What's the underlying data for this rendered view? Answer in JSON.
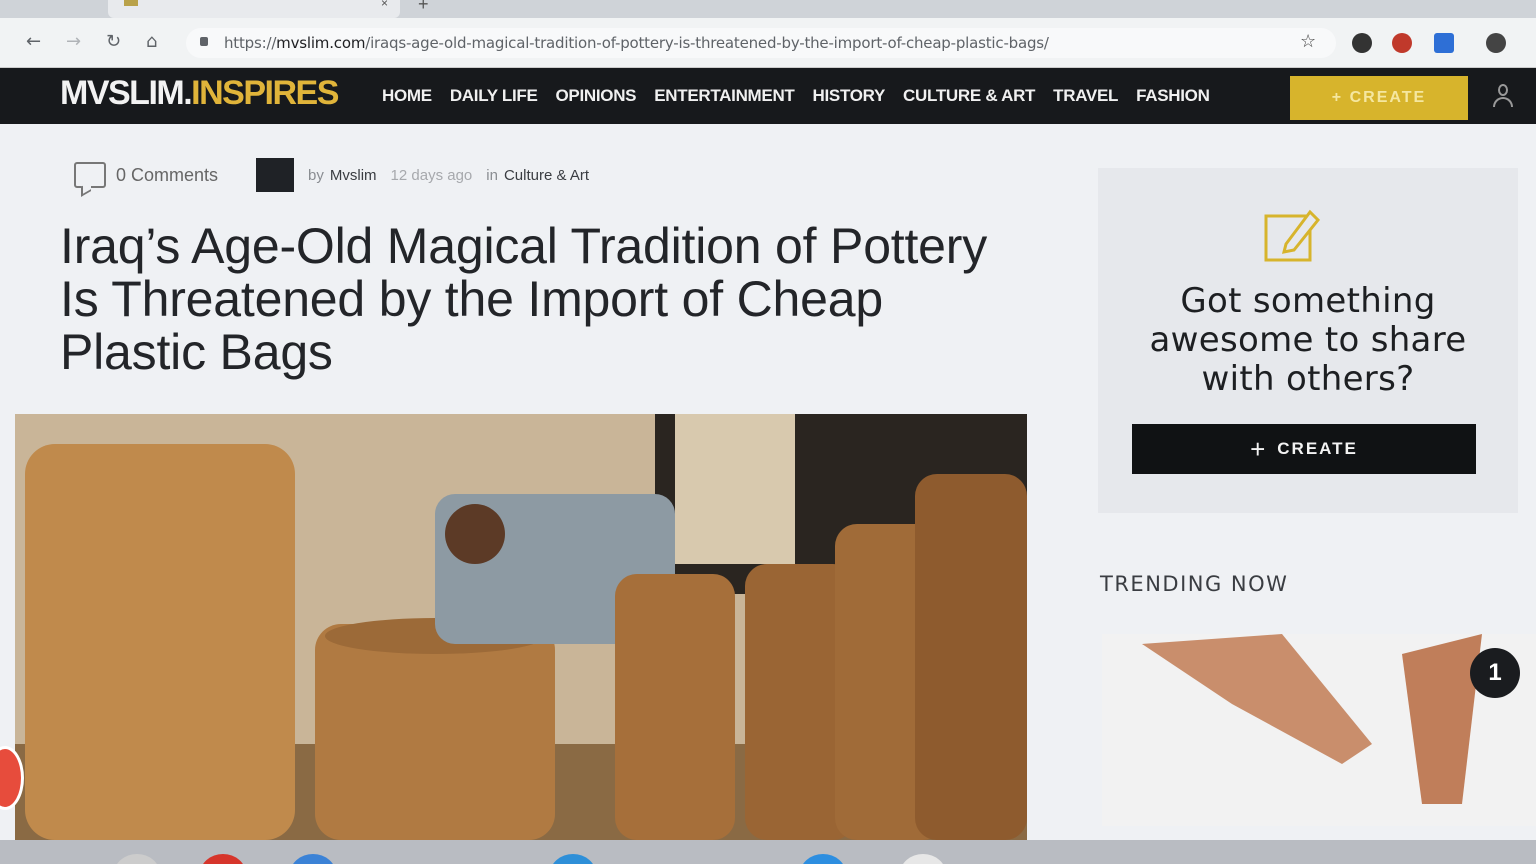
{
  "browser": {
    "url_prefix": "https://",
    "url_host": "mvslim.com",
    "url_path": "/iraqs-age-old-magical-tradition-of-pottery-is-threatened-by-the-import-of-cheap-plastic-bags/",
    "back_icon": "back-arrow-icon",
    "forward_icon": "forward-arrow-icon",
    "reload_icon": "reload-icon",
    "home_icon": "home-icon"
  },
  "site": {
    "logo_main": "MVSLIM.",
    "logo_accent": "INSPIRES",
    "accent_color": "#e0b43a",
    "menu": [
      "HOME",
      "DAILY LIFE",
      "OPINIONS",
      "ENTERTAINMENT",
      "HISTORY",
      "CULTURE & ART",
      "TRAVEL",
      "FASHION"
    ],
    "create_label": "+ CREATE"
  },
  "article": {
    "comments": "0 Comments",
    "by": "by",
    "author": "Mvslim",
    "time": "12 days ago",
    "in": "in",
    "category": "Culture & Art",
    "title": "Iraq’s Age-Old Magical Tradition of Pottery Is Threatened by the Import of Cheap Plastic Bags"
  },
  "sidebar": {
    "share_title": "Got something awesome to share with others?",
    "create_label": "CREATE",
    "trending_label": "TRENDING NOW",
    "trending_rank": "1"
  }
}
